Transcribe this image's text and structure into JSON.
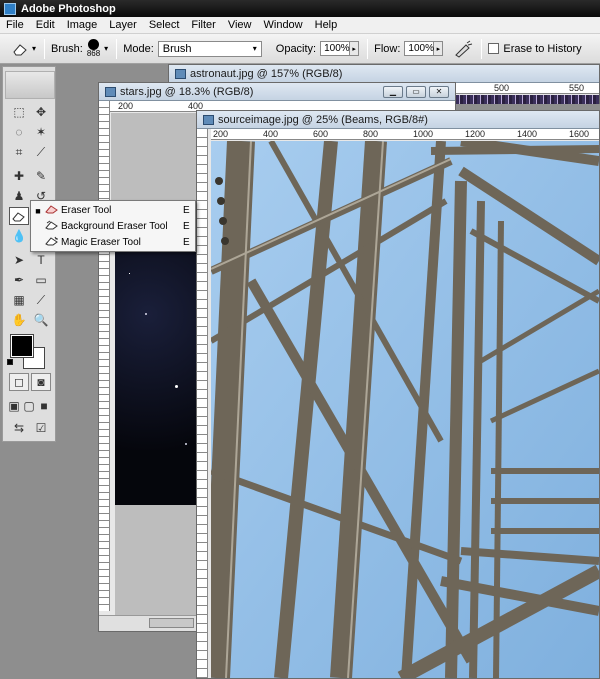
{
  "app": {
    "title": "Adobe Photoshop"
  },
  "menu": [
    "File",
    "Edit",
    "Image",
    "Layer",
    "Select",
    "Filter",
    "View",
    "Window",
    "Help"
  ],
  "options": {
    "brush_label": "Brush:",
    "brush_size": "868",
    "mode_label": "Mode:",
    "mode_value": "Brush",
    "opacity_label": "Opacity:",
    "opacity_value": "100%",
    "flow_label": "Flow:",
    "flow_value": "100%",
    "erase_history_label": "Erase to History"
  },
  "windows": {
    "astronaut": {
      "title": "astronaut.jpg @ 157% (RGB/8)",
      "ruler": [
        "500",
        "550"
      ]
    },
    "stars": {
      "title": "stars.jpg @ 18.3% (RGB/8)",
      "ruler": [
        "200",
        "400"
      ]
    },
    "source": {
      "title": "sourceimage.jpg @ 25% (Beams, RGB/8#)",
      "ruler": [
        "200",
        "400",
        "600",
        "800",
        "1000",
        "1200",
        "1400",
        "1600"
      ]
    }
  },
  "flyout": {
    "items": [
      {
        "label": "Eraser Tool",
        "key": "E",
        "active": true
      },
      {
        "label": "Background Eraser Tool",
        "key": "E",
        "active": false
      },
      {
        "label": "Magic Eraser Tool",
        "key": "E",
        "active": false
      }
    ]
  },
  "colors": {
    "accent": "#2f7fc6",
    "sky": "#9cc3e6",
    "metal": "#7a7467"
  }
}
